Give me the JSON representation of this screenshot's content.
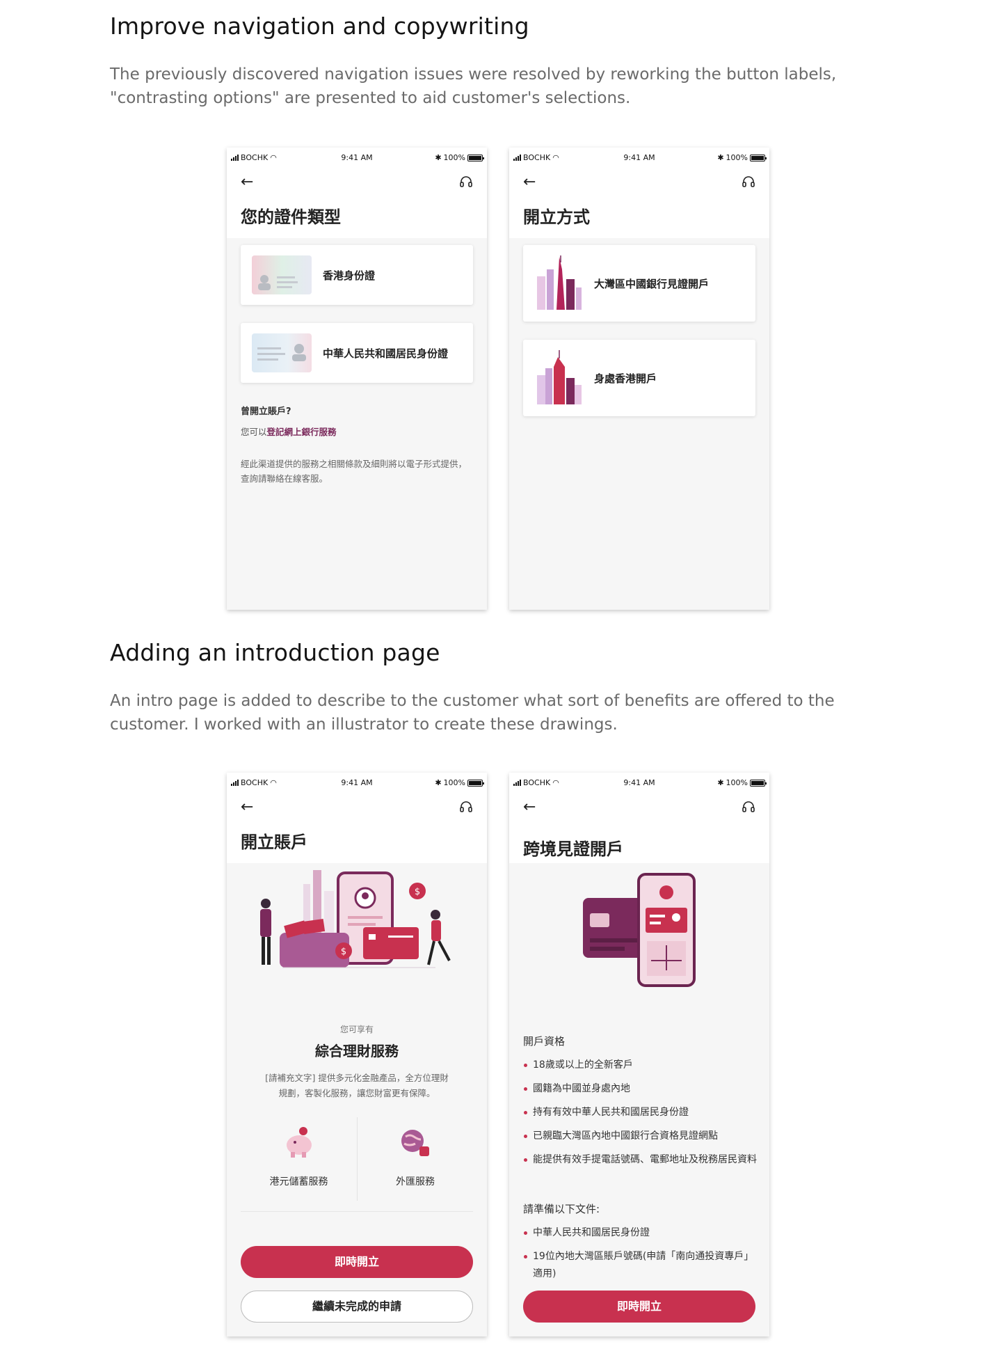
{
  "section1": {
    "title": "Improve navigation and copywriting",
    "desc": "The previously discovered navigation issues were resolved by reworking the button labels, \"contrasting options\" are presented to aid customer's selections."
  },
  "section2": {
    "title": "Adding an introduction page",
    "desc": "An intro page is added to describe to the customer what sort of benefits are offered to the customer. I worked with an illustrator to create these drawings."
  },
  "statusbar": {
    "carrier": "BOCHK",
    "time": "9:41 AM",
    "battery": "100%"
  },
  "nav": {
    "back_icon": "back-arrow-icon",
    "support_icon": "headset-icon"
  },
  "screen1": {
    "title": "您的證件類型",
    "options": [
      "香港身份證",
      "中華人民共和國居民身份證"
    ],
    "existing_head": "曾開立賬戶?",
    "existing_prefix": "您可以",
    "existing_link": "登記網上銀行服務",
    "terms": "經此渠道提供的服務之相關條款及細則將以電子形式提供，查詢請聯絡在線客服。"
  },
  "screen2": {
    "title": "開立方式",
    "options": [
      "大灣區中國銀行見證開戶",
      "身處香港開戶"
    ]
  },
  "screen3": {
    "title": "開立賬戶",
    "enjoy": "您可享有",
    "service_title": "綜合理財服務",
    "service_desc_1": "[請補充文字] 提供多元化金融產品，全方位理財",
    "service_desc_2": "規劃，客製化服務，讓您財富更有保障。",
    "features": [
      "港元儲蓄服務",
      "外匯服務"
    ],
    "primary_button": "即時開立",
    "secondary_button": "繼續未完成的申請"
  },
  "screen4": {
    "title": "跨境見證開戶",
    "eligibility_head": "開戶資格",
    "eligibility": [
      "18歲或以上的全新客戶",
      "國籍為中國並身處內地",
      "持有有效中華人民共和國居民身份證",
      "已親臨大灣區內地中國銀行合資格見證網點",
      "能提供有效手提電話號碼、電郵地址及稅務居民資料"
    ],
    "docs_head": "請準備以下文件:",
    "docs": [
      "中華人民共和國居民身份證",
      "19位內地大灣區賬戶號碼(申請「南向通投資專戶」適用)"
    ],
    "primary_button": "即時開立"
  },
  "colors": {
    "brand": "#c8314f",
    "link": "#7b2a5c",
    "illustration_purple": "#7b2a5c",
    "illustration_pink": "#e9b4c4"
  }
}
